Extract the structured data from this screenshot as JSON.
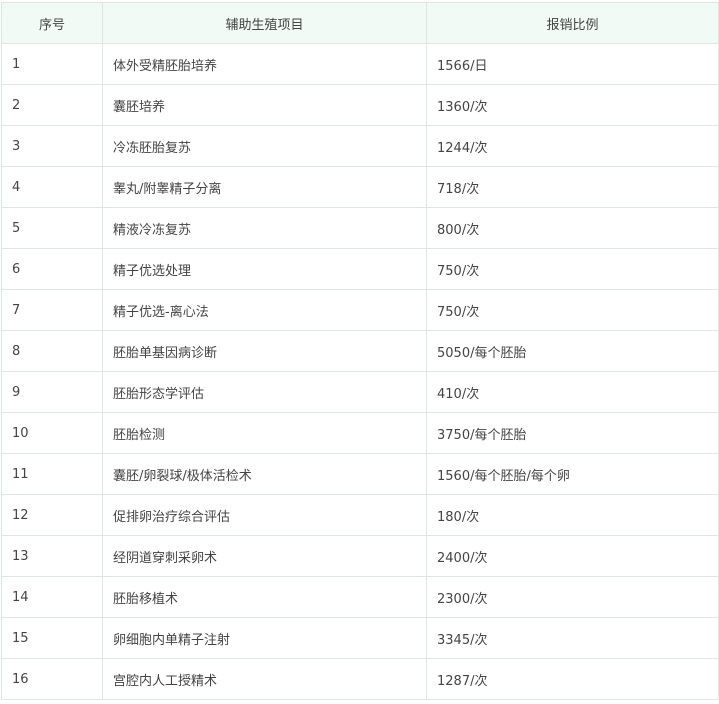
{
  "table": {
    "headers": [
      "序号",
      "辅助生殖项目",
      "报销比例"
    ],
    "rows": [
      {
        "no": "1",
        "item": "体外受精胚胎培养",
        "rate": "1566/日"
      },
      {
        "no": "2",
        "item": "囊胚培养",
        "rate": "1360/次"
      },
      {
        "no": "3",
        "item": "冷冻胚胎复苏",
        "rate": "1244/次"
      },
      {
        "no": "4",
        "item": "睾丸/附睾精子分离",
        "rate": "718/次"
      },
      {
        "no": "5",
        "item": "精液冷冻复苏",
        "rate": "800/次"
      },
      {
        "no": "6",
        "item": "精子优选处理",
        "rate": "750/次"
      },
      {
        "no": "7",
        "item": "精子优选-离心法",
        "rate": "750/次"
      },
      {
        "no": "8",
        "item": "胚胎单基因病诊断",
        "rate": "5050/每个胚胎"
      },
      {
        "no": "9",
        "item": "胚胎形态学评估",
        "rate": "410/次"
      },
      {
        "no": "10",
        "item": "胚胎检测",
        "rate": "3750/每个胚胎"
      },
      {
        "no": "11",
        "item": "囊胚/卵裂球/极体活检术",
        "rate": "1560/每个胚胎/每个卵"
      },
      {
        "no": "12",
        "item": "促排卵治疗综合评估",
        "rate": "180/次"
      },
      {
        "no": "13",
        "item": "经阴道穿刺采卵术",
        "rate": "2400/次"
      },
      {
        "no": "14",
        "item": "胚胎移植术",
        "rate": "2300/次"
      },
      {
        "no": "15",
        "item": "卵细胞内单精子注射",
        "rate": "3345/次"
      },
      {
        "no": "16",
        "item": "宫腔内人工授精术",
        "rate": "1287/次"
      }
    ]
  }
}
